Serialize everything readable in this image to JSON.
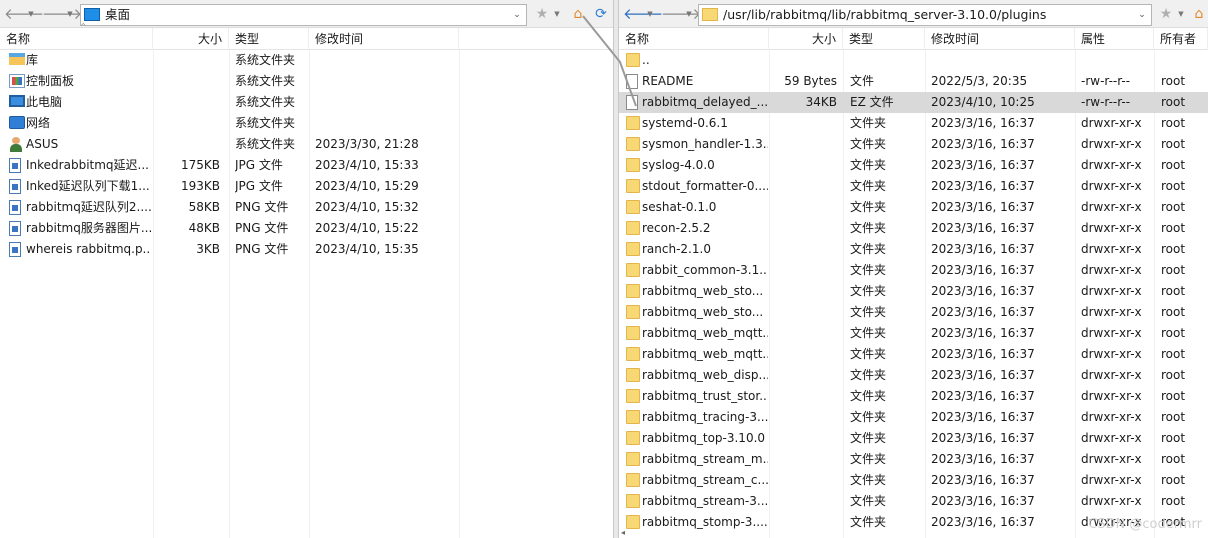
{
  "left_pane": {
    "address": {
      "path": "桌面",
      "icon": "desktop-icon"
    },
    "columns": {
      "name": "名称",
      "size": "大小",
      "type": "类型",
      "modified": "修改时间"
    },
    "rows": [
      {
        "name": "库",
        "size": "",
        "type": "系统文件夹",
        "modified": "",
        "icon": "library-icon"
      },
      {
        "name": "控制面板",
        "size": "",
        "type": "系统文件夹",
        "modified": "",
        "icon": "control-panel-icon"
      },
      {
        "name": "此电脑",
        "size": "",
        "type": "系统文件夹",
        "modified": "",
        "icon": "computer-icon"
      },
      {
        "name": "网络",
        "size": "",
        "type": "系统文件夹",
        "modified": "",
        "icon": "network-icon"
      },
      {
        "name": "ASUS",
        "size": "",
        "type": "系统文件夹",
        "modified": "2023/3/30, 21:28",
        "icon": "user-icon"
      },
      {
        "name": "Inkedrabbitmq延迟...",
        "size": "175KB",
        "type": "JPG 文件",
        "modified": "2023/4/10, 15:33",
        "icon": "image-file-icon"
      },
      {
        "name": "Inked延迟队列下载1....",
        "size": "193KB",
        "type": "JPG 文件",
        "modified": "2023/4/10, 15:29",
        "icon": "image-file-icon"
      },
      {
        "name": "rabbitmq延迟队列2....",
        "size": "58KB",
        "type": "PNG 文件",
        "modified": "2023/4/10, 15:32",
        "icon": "image-file-icon"
      },
      {
        "name": "rabbitmq服务器图片...",
        "size": "48KB",
        "type": "PNG 文件",
        "modified": "2023/4/10, 15:22",
        "icon": "image-file-icon"
      },
      {
        "name": "whereis rabbitmq.p...",
        "size": "3KB",
        "type": "PNG 文件",
        "modified": "2023/4/10, 15:35",
        "icon": "image-file-icon"
      }
    ]
  },
  "right_pane": {
    "address": {
      "path": "/usr/lib/rabbitmq/lib/rabbitmq_server-3.10.0/plugins",
      "icon": "folder-icon"
    },
    "columns": {
      "name": "名称",
      "size": "大小",
      "type": "类型",
      "modified": "修改时间",
      "attrs": "属性",
      "owner": "所有者"
    },
    "rows": [
      {
        "name": "..",
        "size": "",
        "type": "",
        "modified": "",
        "attrs": "",
        "owner": "",
        "icon": "folder-icon"
      },
      {
        "name": "README",
        "size": "59 Bytes",
        "type": "文件",
        "modified": "2022/5/3, 20:35",
        "attrs": "-rw-r--r--",
        "owner": "root",
        "icon": "file-icon"
      },
      {
        "name": "rabbitmq_delayed_...",
        "size": "34KB",
        "type": "EZ 文件",
        "modified": "2023/4/10, 10:25",
        "attrs": "-rw-r--r--",
        "owner": "root",
        "icon": "file-icon",
        "selected": true
      },
      {
        "name": "systemd-0.6.1",
        "size": "",
        "type": "文件夹",
        "modified": "2023/3/16, 16:37",
        "attrs": "drwxr-xr-x",
        "owner": "root",
        "icon": "folder-icon"
      },
      {
        "name": "sysmon_handler-1.3....",
        "size": "",
        "type": "文件夹",
        "modified": "2023/3/16, 16:37",
        "attrs": "drwxr-xr-x",
        "owner": "root",
        "icon": "folder-icon"
      },
      {
        "name": "syslog-4.0.0",
        "size": "",
        "type": "文件夹",
        "modified": "2023/3/16, 16:37",
        "attrs": "drwxr-xr-x",
        "owner": "root",
        "icon": "folder-icon"
      },
      {
        "name": "stdout_formatter-0....",
        "size": "",
        "type": "文件夹",
        "modified": "2023/3/16, 16:37",
        "attrs": "drwxr-xr-x",
        "owner": "root",
        "icon": "folder-icon"
      },
      {
        "name": "seshat-0.1.0",
        "size": "",
        "type": "文件夹",
        "modified": "2023/3/16, 16:37",
        "attrs": "drwxr-xr-x",
        "owner": "root",
        "icon": "folder-icon"
      },
      {
        "name": "recon-2.5.2",
        "size": "",
        "type": "文件夹",
        "modified": "2023/3/16, 16:37",
        "attrs": "drwxr-xr-x",
        "owner": "root",
        "icon": "folder-icon"
      },
      {
        "name": "ranch-2.1.0",
        "size": "",
        "type": "文件夹",
        "modified": "2023/3/16, 16:37",
        "attrs": "drwxr-xr-x",
        "owner": "root",
        "icon": "folder-icon"
      },
      {
        "name": "rabbit_common-3.1...",
        "size": "",
        "type": "文件夹",
        "modified": "2023/3/16, 16:37",
        "attrs": "drwxr-xr-x",
        "owner": "root",
        "icon": "folder-icon"
      },
      {
        "name": "rabbitmq_web_sto...",
        "size": "",
        "type": "文件夹",
        "modified": "2023/3/16, 16:37",
        "attrs": "drwxr-xr-x",
        "owner": "root",
        "icon": "folder-icon"
      },
      {
        "name": "rabbitmq_web_sto...",
        "size": "",
        "type": "文件夹",
        "modified": "2023/3/16, 16:37",
        "attrs": "drwxr-xr-x",
        "owner": "root",
        "icon": "folder-icon"
      },
      {
        "name": "rabbitmq_web_mqtt...",
        "size": "",
        "type": "文件夹",
        "modified": "2023/3/16, 16:37",
        "attrs": "drwxr-xr-x",
        "owner": "root",
        "icon": "folder-icon"
      },
      {
        "name": "rabbitmq_web_mqtt...",
        "size": "",
        "type": "文件夹",
        "modified": "2023/3/16, 16:37",
        "attrs": "drwxr-xr-x",
        "owner": "root",
        "icon": "folder-icon"
      },
      {
        "name": "rabbitmq_web_disp...",
        "size": "",
        "type": "文件夹",
        "modified": "2023/3/16, 16:37",
        "attrs": "drwxr-xr-x",
        "owner": "root",
        "icon": "folder-icon"
      },
      {
        "name": "rabbitmq_trust_stor...",
        "size": "",
        "type": "文件夹",
        "modified": "2023/3/16, 16:37",
        "attrs": "drwxr-xr-x",
        "owner": "root",
        "icon": "folder-icon"
      },
      {
        "name": "rabbitmq_tracing-3....",
        "size": "",
        "type": "文件夹",
        "modified": "2023/3/16, 16:37",
        "attrs": "drwxr-xr-x",
        "owner": "root",
        "icon": "folder-icon"
      },
      {
        "name": "rabbitmq_top-3.10.0",
        "size": "",
        "type": "文件夹",
        "modified": "2023/3/16, 16:37",
        "attrs": "drwxr-xr-x",
        "owner": "root",
        "icon": "folder-icon"
      },
      {
        "name": "rabbitmq_stream_m...",
        "size": "",
        "type": "文件夹",
        "modified": "2023/3/16, 16:37",
        "attrs": "drwxr-xr-x",
        "owner": "root",
        "icon": "folder-icon"
      },
      {
        "name": "rabbitmq_stream_c...",
        "size": "",
        "type": "文件夹",
        "modified": "2023/3/16, 16:37",
        "attrs": "drwxr-xr-x",
        "owner": "root",
        "icon": "folder-icon"
      },
      {
        "name": "rabbitmq_stream-3....",
        "size": "",
        "type": "文件夹",
        "modified": "2023/3/16, 16:37",
        "attrs": "drwxr-xr-x",
        "owner": "root",
        "icon": "folder-icon"
      },
      {
        "name": "rabbitmq_stomp-3....",
        "size": "",
        "type": "文件夹",
        "modified": "2023/3/16, 16:37",
        "attrs": "drwxr-xr-x",
        "owner": "root",
        "icon": "folder-icon"
      }
    ]
  },
  "watermark": "CSDN @codermrr",
  "colors": {
    "selected_row": "#d9d9d9",
    "folder": "#f8d775",
    "toolbar": "#f0f0f0"
  }
}
